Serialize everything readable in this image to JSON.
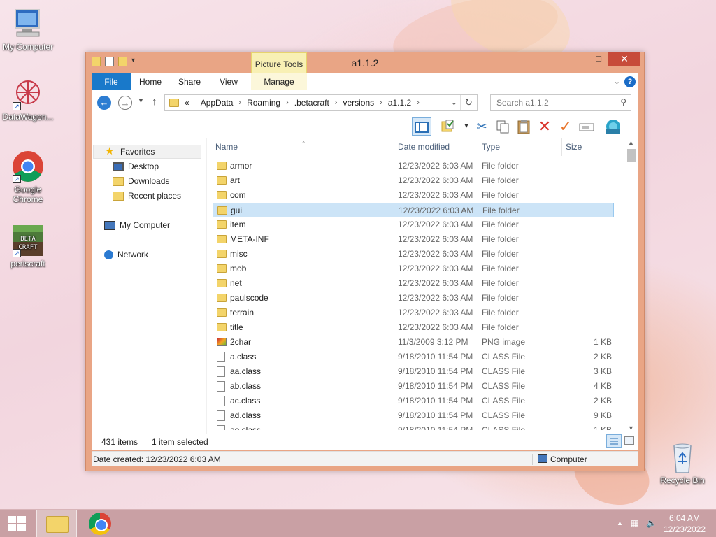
{
  "desktop": {
    "icons": [
      {
        "label": "My Computer",
        "icon": "computer-icon"
      },
      {
        "label": "DataWagon...",
        "icon": "datawagon-icon"
      },
      {
        "label": "Google Chrome",
        "icon": "chrome-icon"
      },
      {
        "label": "periscraft",
        "icon": "betacraft-icon"
      },
      {
        "label": "Recycle Bin",
        "icon": "recycle-bin-icon"
      }
    ]
  },
  "window": {
    "title": "a1.1.2",
    "context_tab": "Picture Tools",
    "tabs": [
      "File",
      "Home",
      "Share",
      "View",
      "Manage"
    ],
    "controls": {
      "minimize": "–",
      "maximize": "□",
      "close": "✕"
    },
    "help": "?"
  },
  "address": {
    "prefix": "«",
    "crumbs": [
      "AppData",
      "Roaming",
      ".betacraft",
      "versions",
      "a1.1.2"
    ],
    "separator": "›"
  },
  "search": {
    "placeholder": "Search a1.1.2"
  },
  "toolbar": {
    "icons": [
      "preview-pane-icon",
      "properties-icon",
      "cut-icon",
      "copy-icon",
      "paste-icon",
      "delete-icon",
      "check-icon",
      "rename-icon",
      "shell-icon"
    ]
  },
  "nav": {
    "favorites": "Favorites",
    "desktop": "Desktop",
    "downloads": "Downloads",
    "recent": "Recent places",
    "computer": "My Computer",
    "network": "Network"
  },
  "columns": {
    "name": "Name",
    "date": "Date modified",
    "type": "Type",
    "size": "Size"
  },
  "files": [
    {
      "name": "armor",
      "date": "12/23/2022 6:03 AM",
      "type": "File folder",
      "size": "",
      "icon": "folder",
      "selected": false
    },
    {
      "name": "art",
      "date": "12/23/2022 6:03 AM",
      "type": "File folder",
      "size": "",
      "icon": "folder",
      "selected": false
    },
    {
      "name": "com",
      "date": "12/23/2022 6:03 AM",
      "type": "File folder",
      "size": "",
      "icon": "folder",
      "selected": false
    },
    {
      "name": "gui",
      "date": "12/23/2022 6:03 AM",
      "type": "File folder",
      "size": "",
      "icon": "folder",
      "selected": true
    },
    {
      "name": "item",
      "date": "12/23/2022 6:03 AM",
      "type": "File folder",
      "size": "",
      "icon": "folder",
      "selected": false
    },
    {
      "name": "META-INF",
      "date": "12/23/2022 6:03 AM",
      "type": "File folder",
      "size": "",
      "icon": "folder",
      "selected": false
    },
    {
      "name": "misc",
      "date": "12/23/2022 6:03 AM",
      "type": "File folder",
      "size": "",
      "icon": "folder",
      "selected": false
    },
    {
      "name": "mob",
      "date": "12/23/2022 6:03 AM",
      "type": "File folder",
      "size": "",
      "icon": "folder",
      "selected": false
    },
    {
      "name": "net",
      "date": "12/23/2022 6:03 AM",
      "type": "File folder",
      "size": "",
      "icon": "folder",
      "selected": false
    },
    {
      "name": "paulscode",
      "date": "12/23/2022 6:03 AM",
      "type": "File folder",
      "size": "",
      "icon": "folder",
      "selected": false
    },
    {
      "name": "terrain",
      "date": "12/23/2022 6:03 AM",
      "type": "File folder",
      "size": "",
      "icon": "folder",
      "selected": false
    },
    {
      "name": "title",
      "date": "12/23/2022 6:03 AM",
      "type": "File folder",
      "size": "",
      "icon": "folder",
      "selected": false
    },
    {
      "name": "2char",
      "date": "11/3/2009 3:12 PM",
      "type": "PNG image",
      "size": "1 KB",
      "icon": "png",
      "selected": false
    },
    {
      "name": "a.class",
      "date": "9/18/2010 11:54 PM",
      "type": "CLASS File",
      "size": "2 KB",
      "icon": "file",
      "selected": false
    },
    {
      "name": "aa.class",
      "date": "9/18/2010 11:54 PM",
      "type": "CLASS File",
      "size": "3 KB",
      "icon": "file",
      "selected": false
    },
    {
      "name": "ab.class",
      "date": "9/18/2010 11:54 PM",
      "type": "CLASS File",
      "size": "4 KB",
      "icon": "file",
      "selected": false
    },
    {
      "name": "ac.class",
      "date": "9/18/2010 11:54 PM",
      "type": "CLASS File",
      "size": "2 KB",
      "icon": "file",
      "selected": false
    },
    {
      "name": "ad.class",
      "date": "9/18/2010 11:54 PM",
      "type": "CLASS File",
      "size": "9 KB",
      "icon": "file",
      "selected": false
    },
    {
      "name": "ae.class",
      "date": "9/18/2010 11:54 PM",
      "type": "CLASS File",
      "size": "1 KB",
      "icon": "file",
      "selected": false
    }
  ],
  "status": {
    "items": "431 items",
    "selected": "1 item selected"
  },
  "details": {
    "created": "Date created: 12/23/2022 6:03 AM",
    "location": "Computer"
  },
  "taskbar": {
    "time": "6:04 AM",
    "date": "12/23/2022"
  }
}
